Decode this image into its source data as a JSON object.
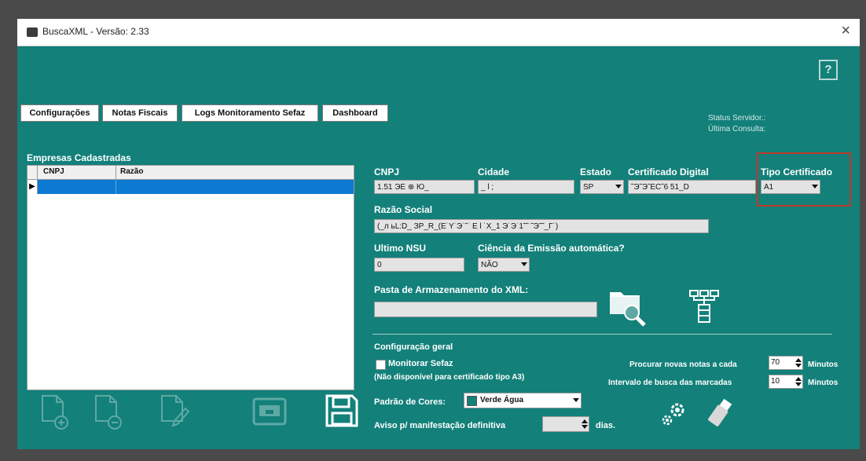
{
  "window": {
    "title": "BuscaXML - Versão: 2.33",
    "close": "×",
    "help": "?"
  },
  "tabs": [
    "Configurações",
    "Notas Fiscais",
    "Logs Monitoramento Sefaz",
    "Dashboard"
  ],
  "status": {
    "servidor": "Status Servidor.:",
    "consulta": "Última Consulta:"
  },
  "empresas": {
    "title": "Empresas Cadastradas",
    "columns": [
      "CNPJ",
      "Razão"
    ],
    "row_indicator": "▶"
  },
  "form": {
    "cnpj": {
      "label": "CNPJ",
      "value": "1.51 ЭЕ ⊕ Ю_"
    },
    "cidade": {
      "label": "Cidade",
      "value": "_ l ;"
    },
    "estado": {
      "label": "Estado",
      "value": "SP"
    },
    "certificado": {
      "label": "Certificado Digital",
      "value": "˜Э˜Э˜ЕС˜6 51_D"
    },
    "tipo": {
      "label": "Tipo Certificado",
      "value": "A1"
    },
    "razao": {
      "label": "Razão Social",
      "value": "(_л ьL:D_ ЗР_R_(Ε˙Υ˙Э˙˜˙ Ε l  ˙Х_1 Э˙Э˙1˜˜ ˜Э˜˜_Γ˙)"
    },
    "nsu": {
      "label": "Ultimo NSU",
      "value": "0"
    },
    "ciencia": {
      "label": "Ciência da Emissão automática?",
      "value": "NÃO"
    },
    "pasta": {
      "label": "Pasta de Armazenamento do XML:",
      "value": ""
    }
  },
  "config": {
    "title": "Configuração geral",
    "monitorar": "Monitorar Sefaz",
    "nao_disponivel": "(Não disponível para certificado tipo A3)",
    "procurar": {
      "label": "Procurar novas notas a cada",
      "value": "70",
      "unit": "Minutos"
    },
    "intervalo": {
      "label": "Intervalo de busca das marcadas",
      "value": "10",
      "unit": "Minutos"
    },
    "padrao": {
      "label": "Padrão de Cores:",
      "value": "Verde Água"
    },
    "aviso": {
      "label": "Aviso p/ manifestação definitiva",
      "value": "",
      "unit": "dias."
    }
  },
  "colors": {
    "background": "#13807a",
    "selection": "#0c7ad3",
    "highlight": "#c0392b"
  },
  "icons": [
    "add-file-icon",
    "remove-file-icon",
    "edit-file-icon",
    "card-icon",
    "save-icon",
    "folder-search-icon",
    "network-icon",
    "gears-icon",
    "usb-icon"
  ]
}
